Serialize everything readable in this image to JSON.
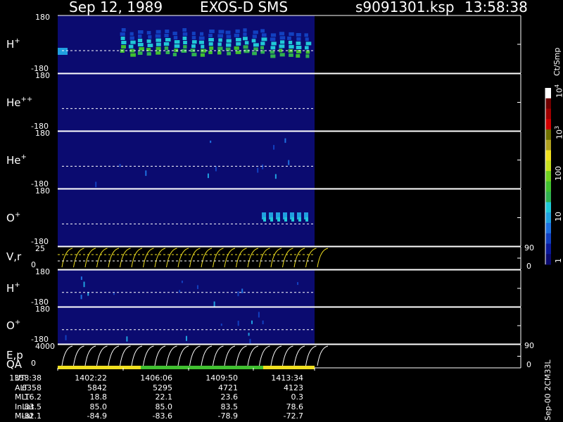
{
  "header": {
    "date": "Sep 12, 1989",
    "mission": "EXOS-D SMS",
    "file": "s9091301.ksp",
    "time": "13:58:38"
  },
  "colorbar": {
    "units": "Ct/Smp",
    "labels": [
      {
        "text": "1",
        "value": 1
      },
      {
        "text": "10",
        "value": 10
      },
      {
        "text": "100",
        "value": 100
      },
      {
        "text": "10",
        "sup": "3",
        "value": 1000
      },
      {
        "text": "10",
        "sup": "4",
        "value": 10000
      }
    ],
    "colors": [
      "#0b0b70",
      "#0b1a9a",
      "#1240c0",
      "#1e70e0",
      "#20a0e0",
      "#20c8d8",
      "#30b050",
      "#40c030",
      "#70d020",
      "#c8e020",
      "#f0e020",
      "#b0a020",
      "#707000",
      "#d00000",
      "#a00000",
      "#700000",
      "#ffffff"
    ]
  },
  "panels": [
    {
      "id": "h-plus",
      "label": "H",
      "sup": "+",
      "ytop": "180",
      "ybot": "-180"
    },
    {
      "id": "he-plusplus",
      "label": "He",
      "sup": "++",
      "ytop": "180",
      "ybot": "-180"
    },
    {
      "id": "he-plus",
      "label": "He",
      "sup": "+",
      "ytop": "180",
      "ybot": "-180"
    },
    {
      "id": "o-plus",
      "label": "O",
      "sup": "+",
      "ytop": "180",
      "ybot": "-180"
    },
    {
      "id": "vr",
      "label": "V,r",
      "ytop": "25",
      "ybot": "0",
      "rtop": "90",
      "rbot": "0"
    },
    {
      "id": "h-plus-2",
      "label": "H",
      "sup": "+",
      "ytop": "180",
      "ybot": "-180"
    },
    {
      "id": "o-plus-2",
      "label": "O",
      "sup": "+",
      "ytop": "180",
      "ybot": "-180"
    },
    {
      "id": "ep",
      "label": "E,p",
      "ytop": "4000",
      "ybot": "0",
      "rtop": "90",
      "rbot": "0"
    }
  ],
  "qa": {
    "label": "QA",
    "segments": [
      {
        "from": "13:58:38",
        "to": "14:04:30",
        "color": "#f0e020"
      },
      {
        "from": "14:04:30",
        "to": "14:10:30",
        "color": "#40c030"
      },
      {
        "from": "14:10:30",
        "to": "14:15:20",
        "color": "#f0e020"
      }
    ]
  },
  "ephemeris": {
    "rows": [
      {
        "name": "UT",
        "values": [
          "1358:38",
          "1402:22",
          "1406:06",
          "1409:50",
          "1413:34"
        ]
      },
      {
        "name": "ALT",
        "values": [
          "6358",
          "5842",
          "5295",
          "4721",
          "4123"
        ]
      },
      {
        "name": "MLT",
        "values": [
          "16.2",
          "18.8",
          "22.1",
          "23.6",
          "0.3"
        ]
      },
      {
        "name": "InLat",
        "values": [
          "83.5",
          "85.0",
          "85.0",
          "83.5",
          "78.6"
        ]
      },
      {
        "name": "MLat",
        "values": [
          "-82.1",
          "-84.9",
          "-83.6",
          "-78.9",
          "-72.7"
        ]
      }
    ]
  },
  "footer_note": "Sep-00 2CM33L",
  "chart_data": {
    "type": "heatmap",
    "title": "Sep 12, 1989    EXOS-D SMS",
    "xlabel": "UT",
    "x_ticks": [
      "1358:38",
      "1402:22",
      "1406:06",
      "1409:50",
      "1413:34"
    ],
    "data_end_ut": "14:15:20",
    "color_scale": "log",
    "zlabel": "Ct/Smp",
    "zlim": [
      1,
      10000
    ],
    "series": [
      {
        "name": "H+",
        "ylim": [
          -180,
          180
        ],
        "baseline": -40,
        "activity": "pulsed bursts 13:59-14:15, peak ~100 Ct/Smp near 0 to 120 deg"
      },
      {
        "name": "He++",
        "ylim": [
          -180,
          180
        ],
        "baseline": -40,
        "activity": "background"
      },
      {
        "name": "He+",
        "ylim": [
          -180,
          180
        ],
        "baseline": -40,
        "activity": "sparse"
      },
      {
        "name": "O+",
        "ylim": [
          -180,
          180
        ],
        "baseline": -40,
        "activity": "burst 14:11-14:15 near 0 deg"
      },
      {
        "name": "V,r",
        "ylim": [
          0,
          25
        ],
        "rlim": [
          0,
          90
        ],
        "sweeps": 23
      },
      {
        "name": "H+ (2)",
        "ylim": [
          -180,
          180
        ],
        "baseline": -40,
        "activity": "sparse"
      },
      {
        "name": "O+ (2)",
        "ylim": [
          -180,
          180
        ],
        "baseline": -40,
        "activity": "sparse"
      },
      {
        "name": "E,p",
        "ylim": [
          0,
          4000
        ],
        "rlim": [
          0,
          90
        ],
        "sweeps": 23
      }
    ]
  }
}
